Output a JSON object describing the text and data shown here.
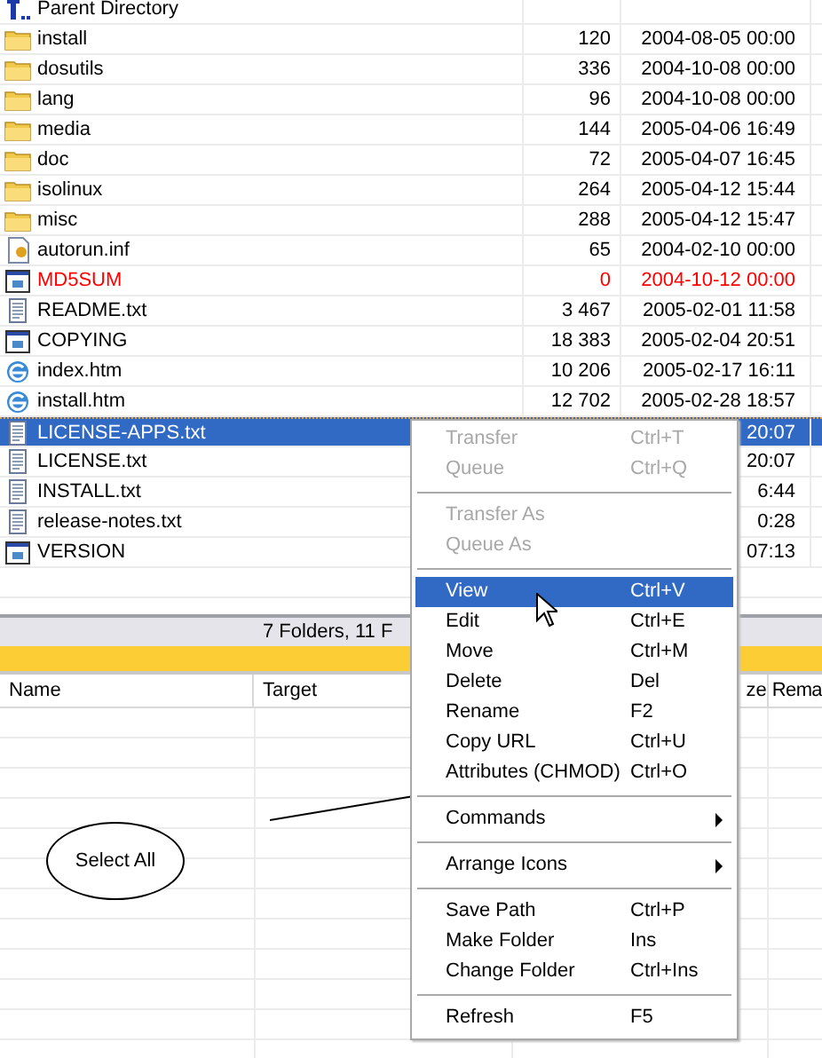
{
  "files": [
    {
      "name": "Parent Directory",
      "kind": "parent",
      "selected": false
    },
    {
      "name": "install",
      "kind": "folder",
      "size": "120",
      "date": "2004-08-05 00:00",
      "selected": false
    },
    {
      "name": "dosutils",
      "kind": "folder",
      "size": "336",
      "date": "2004-10-08 00:00",
      "selected": false
    },
    {
      "name": "lang",
      "kind": "folder",
      "size": "96",
      "date": "2004-10-08 00:00",
      "selected": false
    },
    {
      "name": "media",
      "kind": "folder",
      "size": "144",
      "date": "2005-04-06 16:49",
      "selected": false
    },
    {
      "name": "doc",
      "kind": "folder",
      "size": "72",
      "date": "2005-04-07 16:45",
      "selected": false
    },
    {
      "name": "isolinux",
      "kind": "folder",
      "size": "264",
      "date": "2005-04-12 15:44",
      "selected": false
    },
    {
      "name": "misc",
      "kind": "folder",
      "size": "288",
      "date": "2005-04-12 15:47",
      "selected": false
    },
    {
      "name": "autorun.inf",
      "kind": "config",
      "size": "65",
      "date": "2004-02-10 00:00",
      "selected": false
    },
    {
      "name": "MD5SUM",
      "kind": "app",
      "size": "0",
      "date": "2004-10-12 00:00",
      "color": "#ff0000",
      "selected": false
    },
    {
      "name": "README.txt",
      "kind": "text",
      "size": "3 467",
      "date": "2005-02-01 11:58",
      "selected": false
    },
    {
      "name": "COPYING",
      "kind": "app",
      "size": "18 383",
      "date": "2005-02-04 20:51",
      "selected": false
    },
    {
      "name": "index.htm",
      "kind": "web",
      "size": "10 206",
      "date": "2005-02-17 16:11",
      "selected": false
    },
    {
      "name": "install.htm",
      "kind": "web",
      "size": "12 702",
      "date": "2005-02-28 18:57",
      "selected": false
    },
    {
      "name": "LICENSE-APPS.txt",
      "kind": "text",
      "date": "20:07",
      "selected": true
    },
    {
      "name": "LICENSE.txt",
      "kind": "text",
      "date": "20:07",
      "selected": false
    },
    {
      "name": "INSTALL.txt",
      "kind": "text",
      "date": "6:44",
      "selected": false
    },
    {
      "name": "release-notes.txt",
      "kind": "text",
      "date": "0:28",
      "selected": false
    },
    {
      "name": "VERSION",
      "kind": "app",
      "date": "07:13",
      "selected": false
    }
  ],
  "status_bar": "7 Folders, 11 F",
  "queue_columns": [
    "Name",
    "Target",
    "ze",
    "Rema"
  ],
  "annotation": {
    "label": "Select All"
  },
  "context_menu": [
    {
      "kind": "item",
      "label": "Transfer",
      "shortcut": "Ctrl+T",
      "disabled": true,
      "selected": false,
      "submenu": false
    },
    {
      "kind": "item",
      "label": "Queue",
      "shortcut": "Ctrl+Q",
      "disabled": true,
      "selected": false,
      "submenu": false
    },
    {
      "kind": "separator"
    },
    {
      "kind": "item",
      "label": "Transfer As",
      "disabled": true,
      "selected": false,
      "submenu": false
    },
    {
      "kind": "item",
      "label": "Queue As",
      "disabled": true,
      "selected": false,
      "submenu": false
    },
    {
      "kind": "separator"
    },
    {
      "kind": "item",
      "label": "View",
      "shortcut": "Ctrl+V",
      "disabled": false,
      "selected": true,
      "submenu": false
    },
    {
      "kind": "item",
      "label": "Edit",
      "shortcut": "Ctrl+E",
      "disabled": false,
      "selected": false,
      "submenu": false
    },
    {
      "kind": "item",
      "label": "Move",
      "shortcut": "Ctrl+M",
      "disabled": false,
      "selected": false,
      "submenu": false
    },
    {
      "kind": "item",
      "label": "Delete",
      "shortcut": "Del",
      "disabled": false,
      "selected": false,
      "submenu": false
    },
    {
      "kind": "item",
      "label": "Rename",
      "shortcut": "F2",
      "disabled": false,
      "selected": false,
      "submenu": false
    },
    {
      "kind": "item",
      "label": "Copy URL",
      "shortcut": "Ctrl+U",
      "disabled": false,
      "selected": false,
      "submenu": false
    },
    {
      "kind": "item",
      "label": "Attributes (CHMOD)",
      "shortcut": "Ctrl+O",
      "disabled": false,
      "selected": false,
      "submenu": false
    },
    {
      "kind": "separator"
    },
    {
      "kind": "item",
      "label": "Commands",
      "disabled": false,
      "selected": false,
      "submenu": true
    },
    {
      "kind": "separator"
    },
    {
      "kind": "item",
      "label": "Arrange Icons",
      "disabled": false,
      "selected": false,
      "submenu": true
    },
    {
      "kind": "separator"
    },
    {
      "kind": "item",
      "label": "Save Path",
      "shortcut": "Ctrl+P",
      "disabled": false,
      "selected": false,
      "submenu": false
    },
    {
      "kind": "item",
      "label": "Make Folder",
      "shortcut": "Ins",
      "disabled": false,
      "selected": false,
      "submenu": false
    },
    {
      "kind": "item",
      "label": "Change Folder",
      "shortcut": "Ctrl+Ins",
      "disabled": false,
      "selected": false,
      "submenu": false
    },
    {
      "kind": "separator"
    },
    {
      "kind": "item",
      "label": "Refresh",
      "shortcut": "F5",
      "disabled": false,
      "selected": false,
      "submenu": false
    }
  ]
}
